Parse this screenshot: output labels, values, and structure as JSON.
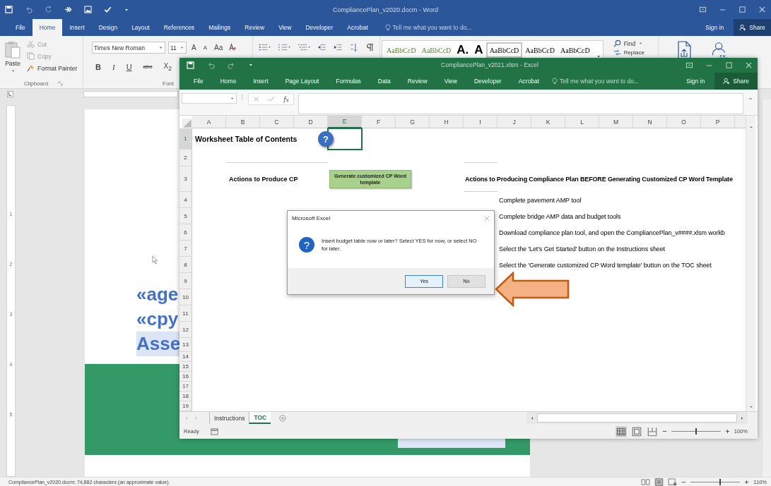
{
  "word": {
    "title": "CompliancePlan_v2020.docm - Word",
    "tabs": [
      {
        "label": "File",
        "selected": false
      },
      {
        "label": "Home",
        "selected": true
      },
      {
        "label": "Insert",
        "selected": false
      },
      {
        "label": "Design",
        "selected": false
      },
      {
        "label": "Layout",
        "selected": false
      },
      {
        "label": "References",
        "selected": false
      },
      {
        "label": "Mailings",
        "selected": false
      },
      {
        "label": "Review",
        "selected": false
      },
      {
        "label": "View",
        "selected": false
      },
      {
        "label": "Developer",
        "selected": false
      },
      {
        "label": "Acrobat",
        "selected": false
      }
    ],
    "tell_me": "Tell me what you want to do...",
    "sign_in": "Sign in",
    "share": "Share",
    "clipboard": {
      "paste": "Paste",
      "cut": "Cut",
      "copy": "Copy",
      "format_painter": "Format Painter",
      "label": "Clipboard"
    },
    "font": {
      "name": "Times New Roman",
      "size": "11",
      "grow": "A",
      "shrink": "A",
      "change_case": "Aa",
      "bold": "B",
      "italic": "I",
      "underline": "U",
      "strike": "abc",
      "subscript": "X$_{2}$",
      "label": "Font"
    },
    "styles": [
      {
        "sample": "AaBbCcD",
        "kind": "heading",
        "selected": false
      },
      {
        "sample": "AaBbCcD",
        "kind": "heading",
        "selected": false
      },
      {
        "sample": "A.",
        "kind": "title",
        "selected": false
      },
      {
        "sample": "A",
        "kind": "title",
        "selected": false
      },
      {
        "sample": "AaBbCcD",
        "kind": "normal",
        "selected": true
      },
      {
        "sample": "AaBbCcD",
        "kind": "normal",
        "selected": false
      },
      {
        "sample": "AaBbCcD",
        "kind": "normal",
        "selected": false
      }
    ],
    "editing": {
      "find": "Find",
      "replace": "Replace"
    },
    "ruler_numbers": [
      "1",
      "2",
      "3",
      "4",
      "5"
    ],
    "document_lines": [
      {
        "text": "«age",
        "highlighted": false
      },
      {
        "text": "«cpy",
        "highlighted": false
      },
      {
        "text": "Asse",
        "highlighted": true
      }
    ],
    "status": "CompliancePlan_v2020.docm: 74,882 characters (an approximate value).",
    "zoom": {
      "level": 0.6,
      "label": "110%"
    }
  },
  "excel": {
    "title": "CompliancePlan_v2021.xlsm - Excel",
    "tabs": [
      "File",
      "Home",
      "Insert",
      "Page Layout",
      "Formulas",
      "Data",
      "Review",
      "View",
      "Developer",
      "Acrobat"
    ],
    "tell_me": "Tell me what you want to do...",
    "sign_in": "Sign in",
    "share": "Share",
    "columns": [
      {
        "label": "A",
        "selected": false
      },
      {
        "label": "B",
        "selected": false
      },
      {
        "label": "C",
        "selected": false
      },
      {
        "label": "D",
        "selected": false
      },
      {
        "label": "E",
        "selected": true
      },
      {
        "label": "F",
        "selected": false
      },
      {
        "label": "G",
        "selected": false
      },
      {
        "label": "H",
        "selected": false
      },
      {
        "label": "I",
        "selected": false
      },
      {
        "label": "J",
        "selected": false
      },
      {
        "label": "K",
        "selected": false
      },
      {
        "label": "L",
        "selected": false
      },
      {
        "label": "M",
        "selected": false
      },
      {
        "label": "N",
        "selected": false
      },
      {
        "label": "O",
        "selected": false
      },
      {
        "label": "P",
        "selected": false
      }
    ],
    "rows": [
      {
        "label": "1",
        "selected": true
      },
      {
        "label": "2",
        "selected": false
      },
      {
        "label": "3",
        "selected": false
      },
      {
        "label": "4",
        "selected": false
      },
      {
        "label": "5",
        "selected": false
      },
      {
        "label": "6",
        "selected": false
      },
      {
        "label": "7",
        "selected": false
      },
      {
        "label": "8",
        "selected": false
      },
      {
        "label": "9",
        "selected": false
      },
      {
        "label": "10",
        "selected": false
      },
      {
        "label": "11",
        "selected": false
      },
      {
        "label": "12",
        "selected": false
      },
      {
        "label": "13",
        "selected": false
      },
      {
        "label": "14",
        "selected": false
      },
      {
        "label": "15",
        "selected": false
      },
      {
        "label": "16",
        "selected": false
      },
      {
        "label": "17",
        "selected": false
      },
      {
        "label": "18",
        "selected": false
      },
      {
        "label": "19",
        "selected": false
      }
    ],
    "sheet_title": "Worksheet Table of Contents",
    "help_mark": "?",
    "left_heading": "Actions to Produce CP",
    "generate_button": "Generate customized CP Word template",
    "right_heading": "Actions to Producing Compliance Plan BEFORE Generating Customized CP Word Template",
    "steps": [
      "Complete pavement AMP tool",
      "Complete bridge AMP data and budget tools",
      "Download compliance plan tool, and open the CompliancePlan_v####.xlsm workb",
      "Select the 'Let's Get Started' button on the Instructions sheet",
      "Select the 'Generate customized CP Word template' button on the TOC sheet"
    ],
    "sheet_tabs": [
      {
        "label": "Instructions",
        "selected": false
      },
      {
        "label": "TOC",
        "selected": true
      }
    ],
    "status": "Ready",
    "zoom": {
      "level": 0.5,
      "label": "100%"
    }
  },
  "dialog": {
    "title": "Microsoft Excel",
    "icon_mark": "?",
    "message": "Insert budget table now or later? Select YES for now, or select NO for later.",
    "buttons": [
      {
        "label": "Yes",
        "selected": true
      },
      {
        "label": "No",
        "selected": false
      }
    ]
  }
}
